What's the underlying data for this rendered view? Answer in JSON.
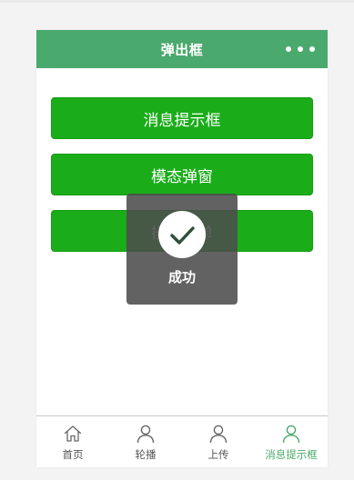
{
  "colors": {
    "primary": "#4aa96c",
    "button": "#1aad19",
    "toast_bg": "#4c4c4c",
    "icon_gray": "#666666",
    "check": "#2f4f3a"
  },
  "navbar": {
    "title": "弹出框",
    "more_icon": "more-dots-icon"
  },
  "buttons": [
    {
      "label": "消息提示框"
    },
    {
      "label": "模态弹窗"
    },
    {
      "label": "操作菜单"
    }
  ],
  "toast": {
    "icon": "checkmark-icon",
    "text": "成功"
  },
  "tabbar": {
    "items": [
      {
        "label": "首页",
        "icon": "home-icon",
        "active": false
      },
      {
        "label": "轮播",
        "icon": "person-icon",
        "active": false
      },
      {
        "label": "上传",
        "icon": "person-icon",
        "active": false
      },
      {
        "label": "消息提示框",
        "icon": "person-icon",
        "active": true
      }
    ]
  }
}
